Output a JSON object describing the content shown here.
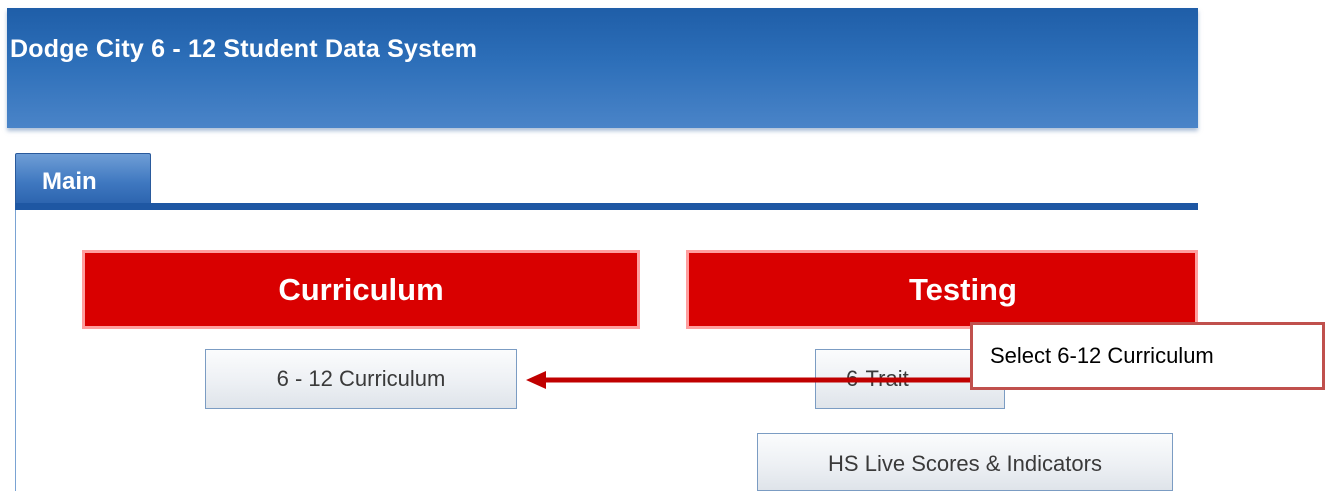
{
  "header": {
    "title": "Dodge City 6 - 12 Student Data System"
  },
  "tabs": [
    {
      "label": "Main",
      "active": true
    }
  ],
  "sections": {
    "curriculum": {
      "title": "Curriculum",
      "buttons": [
        "6 - 12 Curriculum"
      ]
    },
    "testing": {
      "title": "Testing",
      "buttons": [
        "6-Trait",
        "HS Live Scores & Indicators"
      ]
    }
  },
  "annotation": {
    "callout_text": "Select 6-12 Curriculum",
    "arrow_target": "6 - 12 Curriculum"
  },
  "colors": {
    "header_blue": "#2d6fb9",
    "section_red": "#d90000",
    "callout_border": "#c0504d",
    "arrow_red": "#c00000"
  }
}
